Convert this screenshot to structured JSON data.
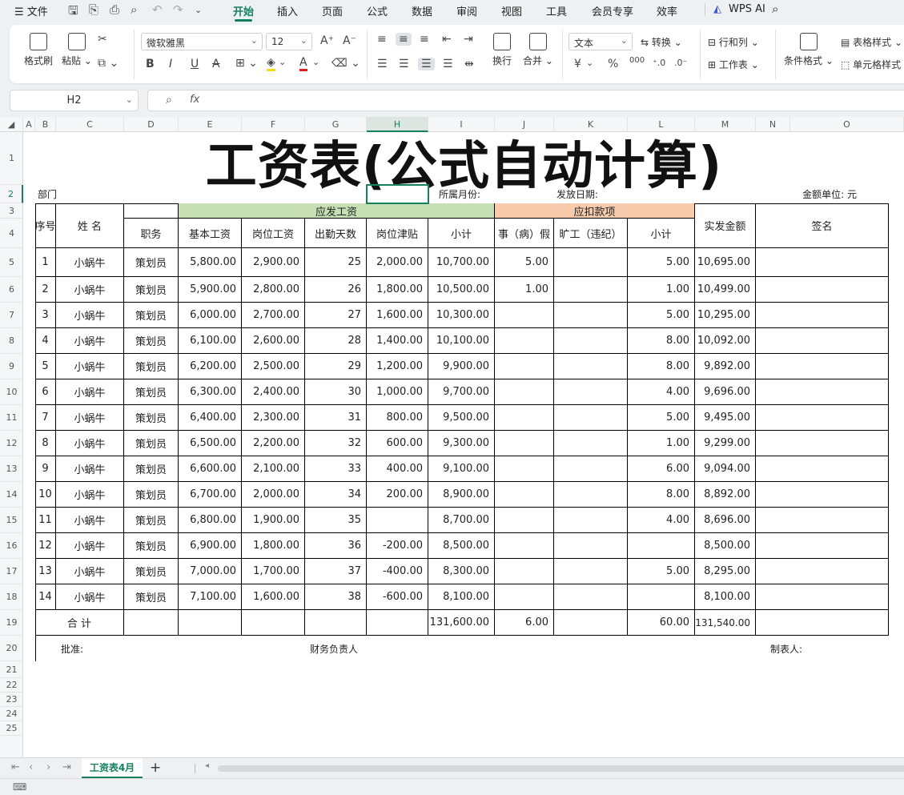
{
  "app": {
    "brand": "WPS",
    "ai_label": "WPS AI"
  },
  "menu": {
    "file_label": "文件",
    "tabs": [
      "开始",
      "插入",
      "页面",
      "公式",
      "数据",
      "审阅",
      "视图",
      "工具",
      "会员专享",
      "效率"
    ],
    "active_tab": "开始"
  },
  "ribbon": {
    "format_painter": "格式刷",
    "paste": "粘贴",
    "font_name": "微软雅黑",
    "font_size": "12",
    "wrap": "换行",
    "merge": "合并",
    "number_format": "文本",
    "convert": "转换",
    "row_col": "行和列",
    "worksheet": "工作表",
    "conditional_format": "条件格式",
    "table_style": "表格样式",
    "cell_style": "单元格样式",
    "bold": "B",
    "italic": "I",
    "underline": "U",
    "currency": "¥",
    "percent": "%",
    "thousands": "000"
  },
  "formula_bar": {
    "name_box": "H2",
    "fx": "fx",
    "formula": ""
  },
  "sheet": {
    "columns": [
      "A",
      "B",
      "C",
      "D",
      "E",
      "F",
      "G",
      "H",
      "I",
      "J",
      "K",
      "L",
      "M",
      "N",
      "O"
    ],
    "rows": [
      "1",
      "2",
      "3",
      "4",
      "5",
      "6",
      "7",
      "8",
      "9",
      "10",
      "11",
      "12",
      "13",
      "14",
      "15",
      "16",
      "17",
      "18",
      "19",
      "20",
      "21",
      "22",
      "23",
      "24",
      "25"
    ],
    "title": "工资表(公式自动计算)",
    "info": {
      "dept": "部门",
      "month": "所属月份:",
      "pay_date": "发放日期:",
      "unit": "金额单位: 元"
    },
    "headers": {
      "seq": "序号",
      "name": "姓  名",
      "job": "职务",
      "gross_group": "应发工资",
      "base": "基本工资",
      "post": "岗位工资",
      "days": "出勤天数",
      "allowance": "岗位津贴",
      "subtotal1": "小计",
      "deduct_group": "应扣款项",
      "leave": "事（病）假",
      "absent": "旷工（违纪）",
      "subtotal2": "小计",
      "net": "实发金额",
      "sign": "签名"
    },
    "data_rows": [
      [
        "1",
        "小蜗牛",
        "策划员",
        "5,800.00",
        "2,900.00",
        "25",
        "2,000.00",
        "10,700.00",
        "5.00",
        "",
        "5.00",
        "10,695.00",
        ""
      ],
      [
        "2",
        "小蜗牛",
        "策划员",
        "5,900.00",
        "2,800.00",
        "26",
        "1,800.00",
        "10,500.00",
        "1.00",
        "",
        "1.00",
        "10,499.00",
        ""
      ],
      [
        "3",
        "小蜗牛",
        "策划员",
        "6,000.00",
        "2,700.00",
        "27",
        "1,600.00",
        "10,300.00",
        "",
        "",
        "5.00",
        "10,295.00",
        ""
      ],
      [
        "4",
        "小蜗牛",
        "策划员",
        "6,100.00",
        "2,600.00",
        "28",
        "1,400.00",
        "10,100.00",
        "",
        "",
        "8.00",
        "10,092.00",
        ""
      ],
      [
        "5",
        "小蜗牛",
        "策划员",
        "6,200.00",
        "2,500.00",
        "29",
        "1,200.00",
        "9,900.00",
        "",
        "",
        "8.00",
        "9,892.00",
        ""
      ],
      [
        "6",
        "小蜗牛",
        "策划员",
        "6,300.00",
        "2,400.00",
        "30",
        "1,000.00",
        "9,700.00",
        "",
        "",
        "4.00",
        "9,696.00",
        ""
      ],
      [
        "7",
        "小蜗牛",
        "策划员",
        "6,400.00",
        "2,300.00",
        "31",
        "800.00",
        "9,500.00",
        "",
        "",
        "5.00",
        "9,495.00",
        ""
      ],
      [
        "8",
        "小蜗牛",
        "策划员",
        "6,500.00",
        "2,200.00",
        "32",
        "600.00",
        "9,300.00",
        "",
        "",
        "1.00",
        "9,299.00",
        ""
      ],
      [
        "9",
        "小蜗牛",
        "策划员",
        "6,600.00",
        "2,100.00",
        "33",
        "400.00",
        "9,100.00",
        "",
        "",
        "6.00",
        "9,094.00",
        ""
      ],
      [
        "10",
        "小蜗牛",
        "策划员",
        "6,700.00",
        "2,000.00",
        "34",
        "200.00",
        "8,900.00",
        "",
        "",
        "8.00",
        "8,892.00",
        ""
      ],
      [
        "11",
        "小蜗牛",
        "策划员",
        "6,800.00",
        "1,900.00",
        "35",
        "",
        "8,700.00",
        "",
        "",
        "4.00",
        "8,696.00",
        ""
      ],
      [
        "12",
        "小蜗牛",
        "策划员",
        "6,900.00",
        "1,800.00",
        "36",
        "-200.00",
        "8,500.00",
        "",
        "",
        "",
        "8,500.00",
        ""
      ],
      [
        "13",
        "小蜗牛",
        "策划员",
        "7,000.00",
        "1,700.00",
        "37",
        "-400.00",
        "8,300.00",
        "",
        "",
        "5.00",
        "8,295.00",
        ""
      ],
      [
        "14",
        "小蜗牛",
        "策划员",
        "7,100.00",
        "1,600.00",
        "38",
        "-600.00",
        "8,100.00",
        "",
        "",
        "",
        "8,100.00",
        ""
      ]
    ],
    "total_row": {
      "label": "合      计",
      "subtotal1": "131,600.00",
      "leave": "6.00",
      "subtotal2": "60.00",
      "net": "131,540.00"
    },
    "footer": {
      "approve": "批准:",
      "finance": "财务负责人",
      "maker": "制表人:"
    }
  },
  "sheet_tabs": {
    "active": "工资表4月",
    "add": "+"
  },
  "colors": {
    "accent": "#14805e",
    "gross_header_bg": "#c6e0b4",
    "deduct_header_bg": "#f8cbad"
  }
}
